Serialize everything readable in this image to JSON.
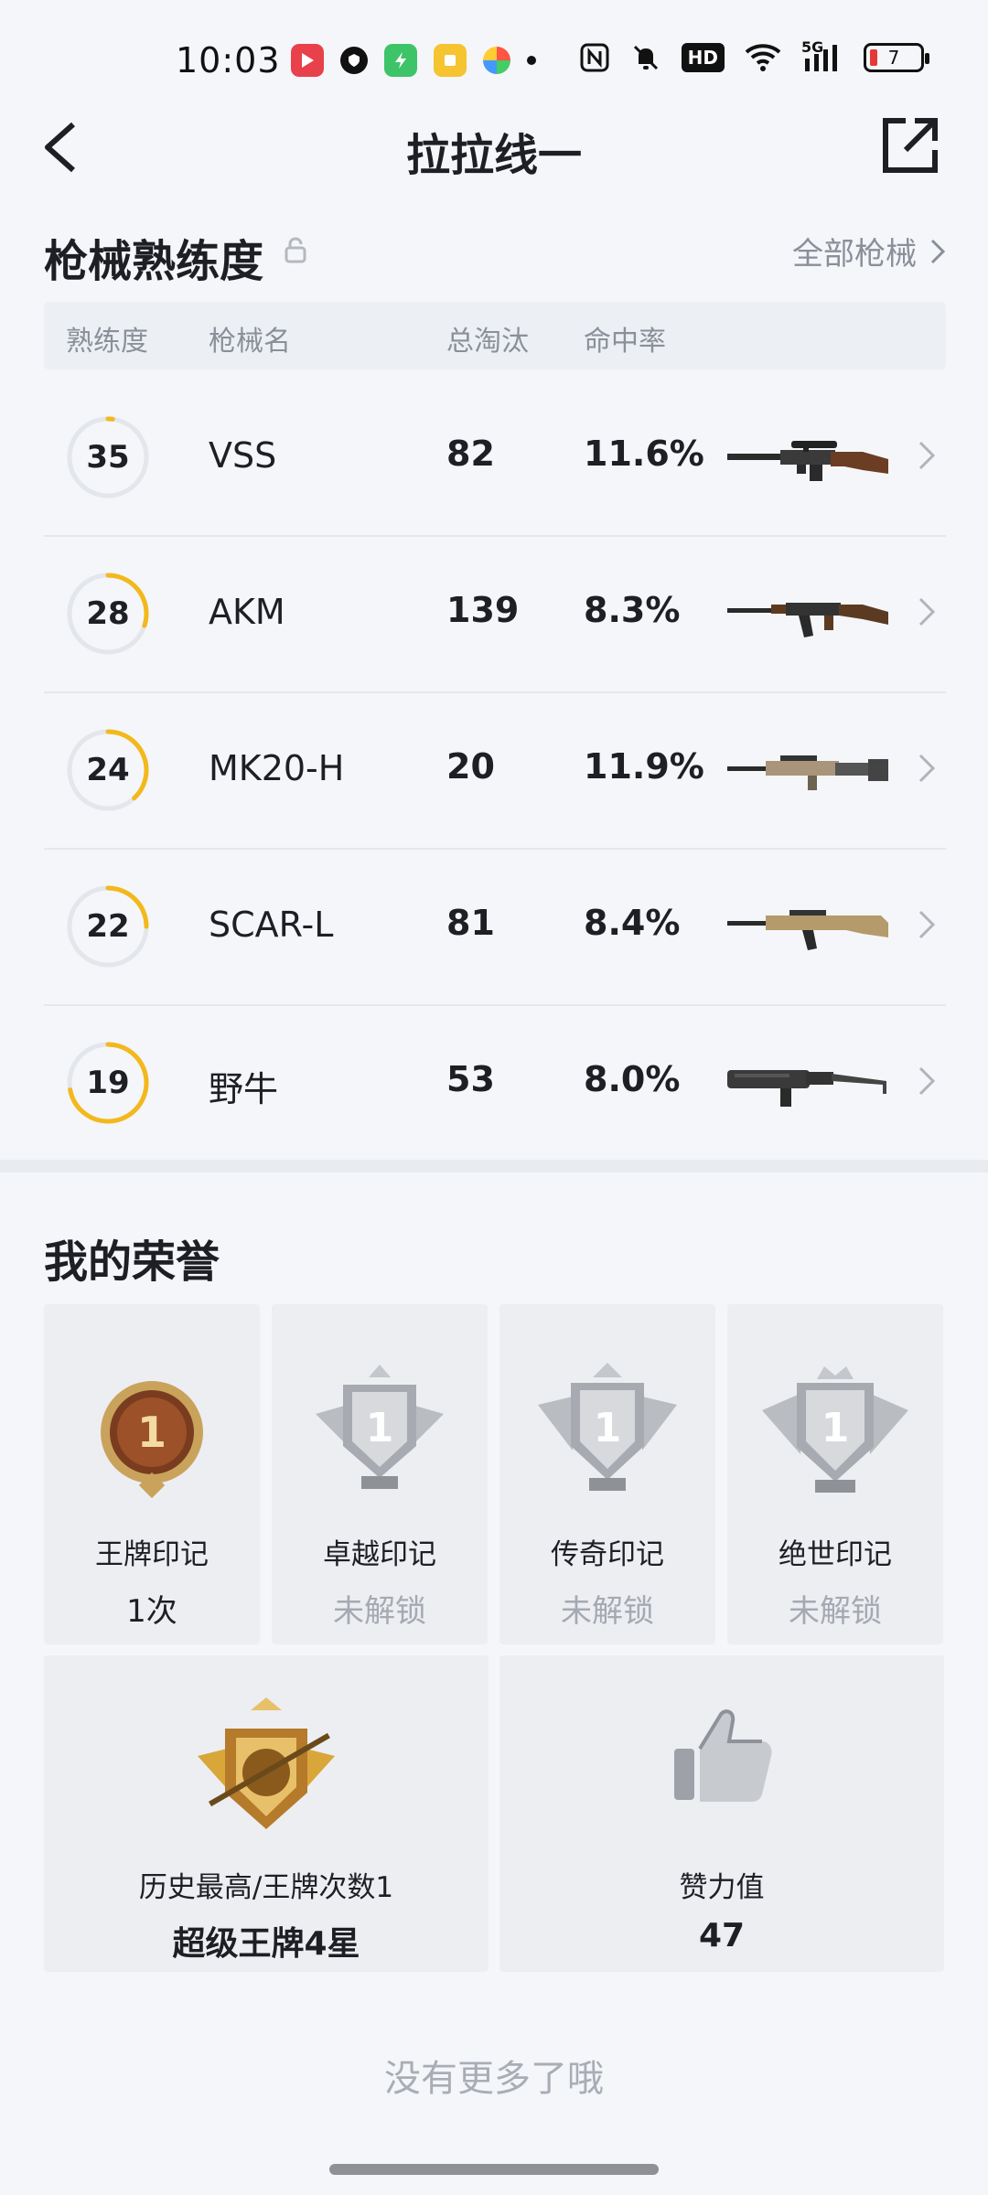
{
  "status_bar": {
    "time": "10:03",
    "app_icons": [
      "video-app-icon",
      "shield-app-icon",
      "charge-app-icon",
      "notes-app-icon",
      "photos-app-icon"
    ],
    "system_icons": [
      "nfc-icon",
      "mute-icon",
      "hd-icon",
      "wifi-icon",
      "signal-5g-icon",
      "battery-icon"
    ],
    "hd_label": "HD",
    "net_label": "5G",
    "battery_level": "7"
  },
  "header": {
    "title": "拉拉线一"
  },
  "weapons": {
    "title": "枪械熟练度",
    "all_link": "全部枪械",
    "columns": [
      "熟练度",
      "枪械名",
      "总淘汰",
      "命中率"
    ],
    "rows": [
      {
        "level": "35",
        "name": "VSS",
        "kills": "82",
        "accuracy": "11.6%",
        "progress": 0.02
      },
      {
        "level": "28",
        "name": "AKM",
        "kills": "139",
        "accuracy": "8.3%",
        "progress": 0.3
      },
      {
        "level": "24",
        "name": "MK20-H",
        "kills": "20",
        "accuracy": "11.9%",
        "progress": 0.38
      },
      {
        "level": "22",
        "name": "SCAR-L",
        "kills": "81",
        "accuracy": "8.4%",
        "progress": 0.25
      },
      {
        "level": "19",
        "name": "野牛",
        "kills": "53",
        "accuracy": "8.0%",
        "progress": 0.72
      }
    ],
    "accent_color": "#f3b81c"
  },
  "honors": {
    "title": "我的荣誉",
    "badges": [
      {
        "name": "王牌印记",
        "value": "1次",
        "locked": false
      },
      {
        "name": "卓越印记",
        "value": "未解锁",
        "locked": true
      },
      {
        "name": "传奇印记",
        "value": "未解锁",
        "locked": true
      },
      {
        "name": "绝世印记",
        "value": "未解锁",
        "locked": true
      }
    ],
    "medal_digit": "1",
    "history": {
      "label": "历史最高/王牌次数1",
      "value": "超级王牌4星"
    },
    "likes": {
      "label": "赞力值",
      "value": "47"
    }
  },
  "footer": {
    "text": "没有更多了哦"
  }
}
